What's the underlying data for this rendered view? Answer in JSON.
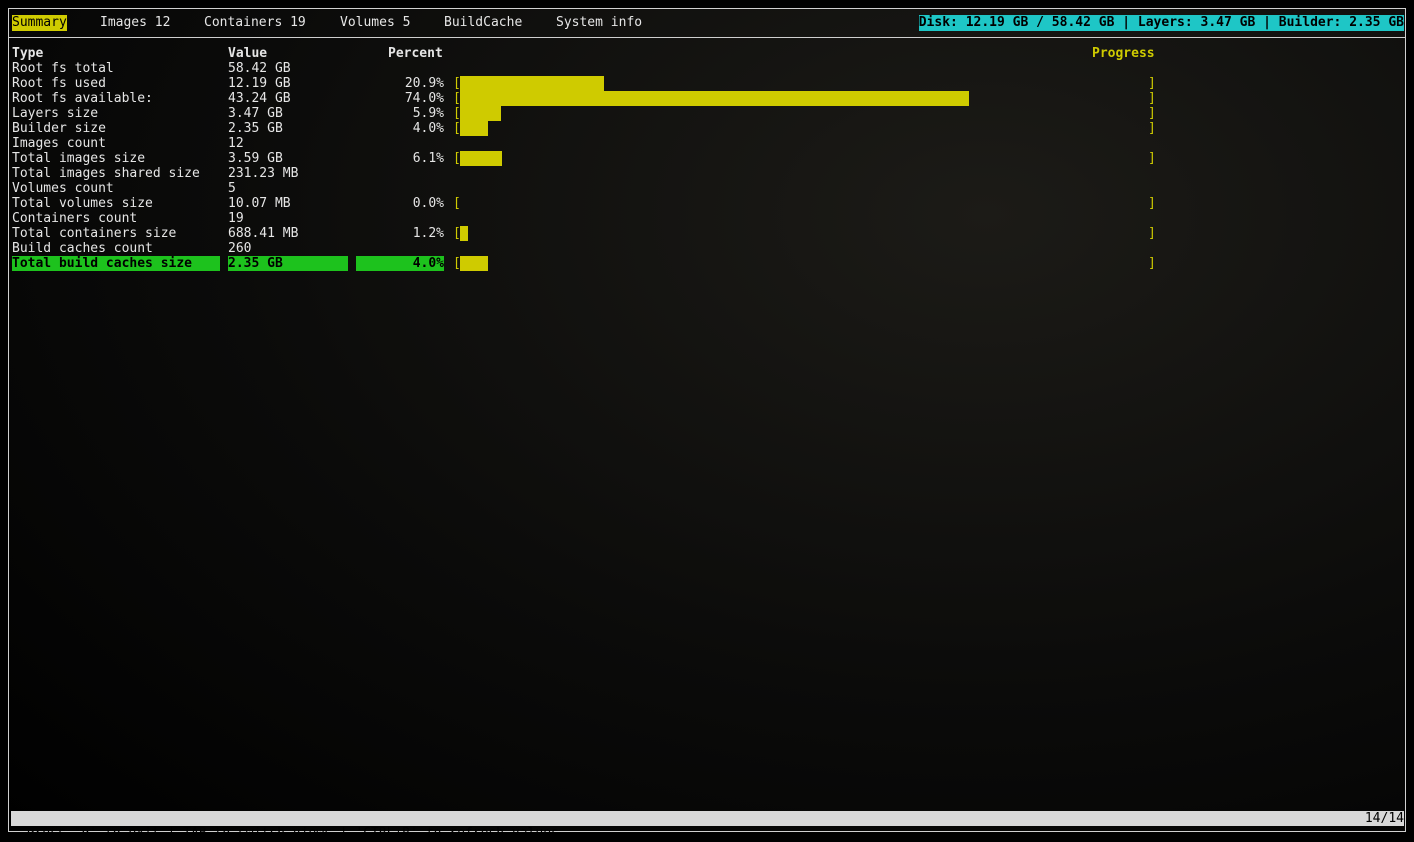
{
  "tabs": [
    {
      "label": "Summary",
      "active": true
    },
    {
      "label": "Images 12",
      "active": false
    },
    {
      "label": "Containers 19",
      "active": false
    },
    {
      "label": "Volumes 5",
      "active": false
    },
    {
      "label": "BuildCache",
      "active": false
    },
    {
      "label": "System info",
      "active": false
    }
  ],
  "disk_info": "Disk: 12.19 GB / 58.42 GB | Layers: 3.47 GB | Builder: 2.35 GB",
  "headers": {
    "type": "Type",
    "value": "Value",
    "percent": "Percent",
    "progress": "Progress"
  },
  "rows": [
    {
      "type": "Root fs total",
      "value": "58.42 GB",
      "percent": "",
      "progress": null
    },
    {
      "type": "Root fs used",
      "value": "12.19 GB",
      "percent": "20.9%",
      "progress": 0.209
    },
    {
      "type": "Root fs available:",
      "value": "43.24 GB",
      "percent": "74.0%",
      "progress": 0.74
    },
    {
      "type": "Layers size",
      "value": "3.47 GB",
      "percent": "5.9%",
      "progress": 0.059
    },
    {
      "type": "Builder size",
      "value": "2.35 GB",
      "percent": "4.0%",
      "progress": 0.04
    },
    {
      "type": "Images count",
      "value": "12",
      "percent": "",
      "progress": null
    },
    {
      "type": "Total images size",
      "value": "3.59 GB",
      "percent": "6.1%",
      "progress": 0.061
    },
    {
      "type": "Total images shared size",
      "value": "231.23 MB",
      "percent": "",
      "progress": null
    },
    {
      "type": "Volumes count",
      "value": "5",
      "percent": "",
      "progress": null
    },
    {
      "type": "Total volumes size",
      "value": "10.07 MB",
      "percent": "0.0%",
      "progress": 0.0
    },
    {
      "type": "Containers count",
      "value": "19",
      "percent": "",
      "progress": null
    },
    {
      "type": "Total containers size",
      "value": "688.41 MB",
      "percent": "1.2%",
      "progress": 0.012
    },
    {
      "type": "Build caches count",
      "value": "260",
      "percent": "",
      "progress": null
    },
    {
      "type": "Total build caches size",
      "value": "2.35 GB",
      "percent": "4.0%",
      "progress": 0.04,
      "selected": true
    }
  ],
  "progress_brackets": {
    "open": "[",
    "close": "]"
  },
  "status_bar": {
    "help": "Press 'q' to exit | TAB to switch views | 'CTRL+R' to refresh values",
    "page": "14/14"
  },
  "colors": {
    "accent_yellow": "#cfcb00",
    "disk_info_bg": "#1ec6c6",
    "selected_row_bg": "#1dc21d",
    "status_bar_bg": "#d8d8d8"
  }
}
